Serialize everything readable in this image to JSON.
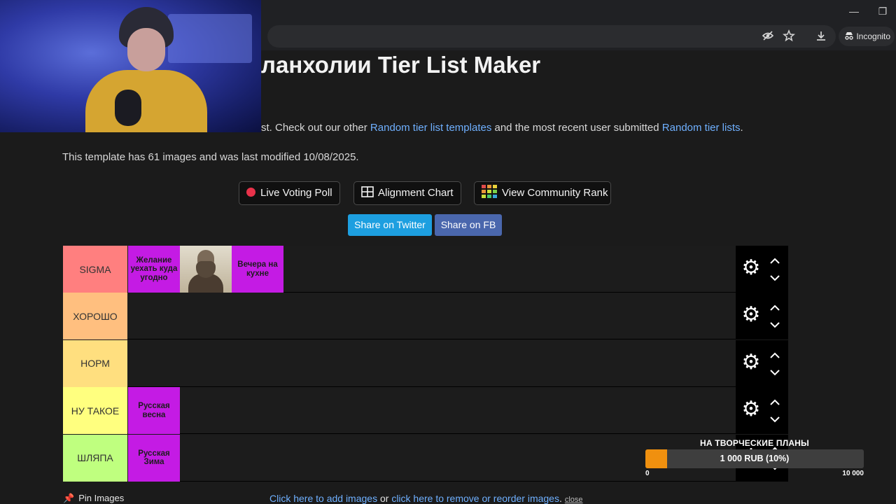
{
  "browser": {
    "incognito_label": "Incognito",
    "minimize_glyph": "—",
    "restore_glyph": "❐",
    "icons": [
      "eye-off-icon",
      "star-icon",
      "download-icon",
      "incognito-icon"
    ]
  },
  "page": {
    "title": "ланхолии Tier List Maker",
    "intro_prefix": "st. Check out our other ",
    "intro_link1": "Random tier list templates",
    "intro_middle": " and the most recent user submitted ",
    "intro_link2": "Random tier lists",
    "intro_suffix": ".",
    "template_info": "This template has 61 images and was last modified 10/08/2025."
  },
  "actions": {
    "live_voting": "Live Voting Poll",
    "alignment_chart": "Alignment Chart",
    "community_rank": "View Community Rank",
    "share_twitter": "Share on Twitter",
    "share_fb": "Share on FB"
  },
  "tiers": [
    {
      "label": "SIGMA",
      "color": "#ff7f7f",
      "items": [
        "Желание уехать куда угодно",
        "",
        "Вечера на кухне"
      ]
    },
    {
      "label": "ХОРОШО",
      "color": "#ffbf7f",
      "items": []
    },
    {
      "label": "НОРМ",
      "color": "#ffdf7f",
      "items": []
    },
    {
      "label": "НУ ТАКОЕ",
      "color": "#ffff7f",
      "items": [
        "Русская весна"
      ]
    },
    {
      "label": "ШЛЯПА",
      "color": "#bfff7f",
      "items": [
        "Русская Зима"
      ]
    }
  ],
  "tile_color": "#c41be4",
  "donation": {
    "title": "НА ТВОРЧЕСКИЕ ПЛАНЫ",
    "amount_label": "1 000 RUB (10%)",
    "progress": 0.1,
    "min_label": "0",
    "max_label": "10 000",
    "fill_color": "#f0900f"
  },
  "footer": {
    "pin_label": "Pin Images",
    "add_link": "Click here to add images",
    "or_text": " or ",
    "remove_link": "click here to remove or reorder images",
    "dot": ".",
    "close_label": "close"
  }
}
